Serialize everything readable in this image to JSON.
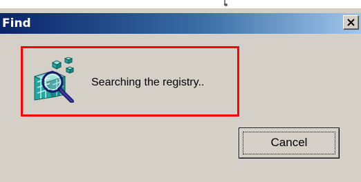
{
  "window": {
    "title": "Find",
    "close_icon": "close-x-icon"
  },
  "status": {
    "icon": "registry-search-icon",
    "message": "Searching the registry.."
  },
  "buttons": {
    "cancel_label": "Cancel"
  },
  "colors": {
    "titlebar_start": "#0a246a",
    "titlebar_end": "#a6caf0",
    "dialog_face": "#d4d0c8",
    "highlight_border": "#ff0000"
  }
}
